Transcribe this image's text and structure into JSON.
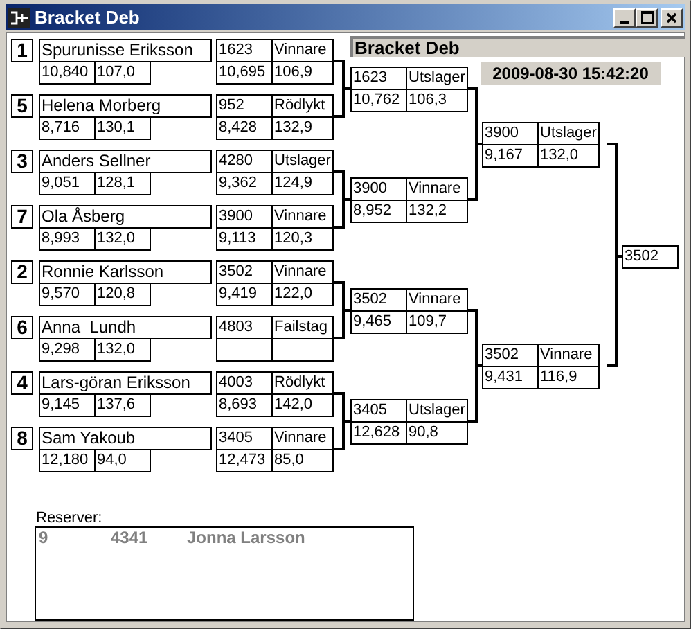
{
  "window": {
    "title": "Bracket Deb",
    "controls": [
      {
        "kind": "minimize"
      },
      {
        "kind": "maximize"
      },
      {
        "kind": "close"
      }
    ]
  },
  "header": {
    "title": "Bracket Deb",
    "date": "2009-08-30 15:42:20"
  },
  "seeds": [
    {
      "seed": "1",
      "name": "Spurunisse Eriksson",
      "time": "10,840",
      "speed": "107,0"
    },
    {
      "seed": "5",
      "name": "Helena Morberg",
      "time": "8,716",
      "speed": "130,1"
    },
    {
      "seed": "3",
      "name": "Anders Sellner",
      "time": "9,051",
      "speed": "128,1"
    },
    {
      "seed": "7",
      "name": "Ola Åsberg",
      "time": "8,993",
      "speed": "132,0"
    },
    {
      "seed": "2",
      "name": "Ronnie Karlsson",
      "time": "9,570",
      "speed": "120,8"
    },
    {
      "seed": "6",
      "name": "Anna  Lundh",
      "time": "9,298",
      "speed": "132,0"
    },
    {
      "seed": "4",
      "name": "Lars-göran Eriksson",
      "time": "9,145",
      "speed": "137,6"
    },
    {
      "seed": "8",
      "name": "Sam Yakoub",
      "time": "12,180",
      "speed": "94,0"
    }
  ],
  "round_1": [
    {
      "number": "1623",
      "status": "Vinnare",
      "time": "10,695",
      "speed": "106,9"
    },
    {
      "number": "952",
      "status": "Rödlykt",
      "time": "8,428",
      "speed": "132,9"
    },
    {
      "number": "4280",
      "status": "Utslager",
      "time": "9,362",
      "speed": "124,9"
    },
    {
      "number": "3900",
      "status": "Vinnare",
      "time": "9,113",
      "speed": "120,3"
    },
    {
      "number": "3502",
      "status": "Vinnare",
      "time": "9,419",
      "speed": "122,0"
    },
    {
      "number": "4803",
      "status": "Failstag"
    },
    {
      "number": "4003",
      "status": "Rödlykt",
      "time": "8,693",
      "speed": "142,0"
    },
    {
      "number": "3405",
      "status": "Vinnare",
      "time": "12,473",
      "speed": "85,0"
    }
  ],
  "round_2": [
    {
      "number": "1623",
      "status": "Utslager",
      "time": "10,762",
      "speed": "106,3"
    },
    {
      "number": "3900",
      "status": "Vinnare",
      "time": "8,952",
      "speed": "132,2"
    },
    {
      "number": "3502",
      "status": "Vinnare",
      "time": "9,465",
      "speed": "109,7"
    },
    {
      "number": "3405",
      "status": "Utslager",
      "time": "12,628",
      "speed": "90,8"
    }
  ],
  "round_3": [
    {
      "number": "3900",
      "status": "Utslager",
      "time": "9,167",
      "speed": "132,0"
    },
    {
      "number": "3502",
      "status": "Vinnare",
      "time": "9,431",
      "speed": "116,9"
    }
  ],
  "final": {
    "number": "3502"
  },
  "reserves": {
    "label": "Reserver:",
    "rows": [
      {
        "seed": "9",
        "number": "4341",
        "name": "Jonna Larsson"
      }
    ]
  }
}
